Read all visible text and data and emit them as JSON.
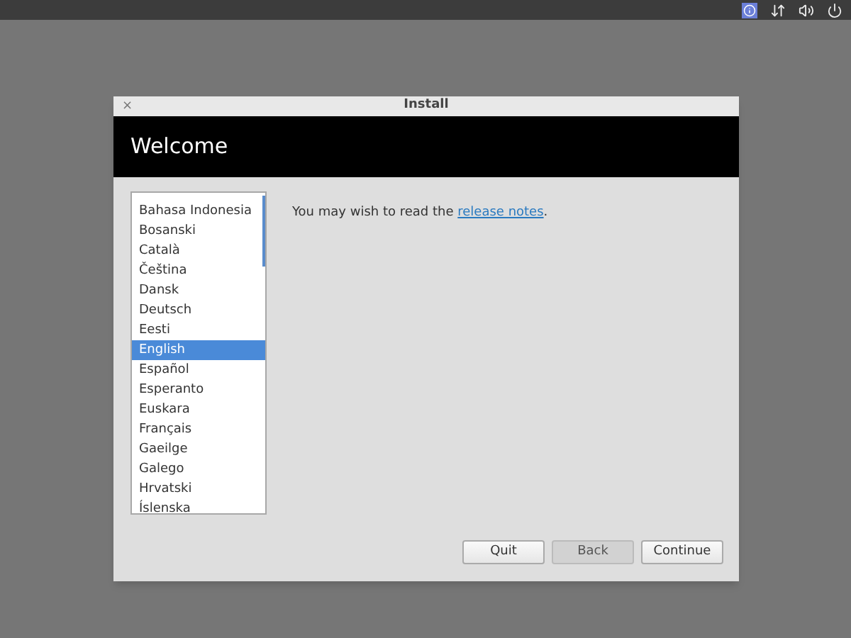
{
  "window": {
    "title": "Install",
    "close": "×"
  },
  "header": {
    "title": "Welcome"
  },
  "languages": [
    {
      "label": "Bahasa Indonesia",
      "selected": false
    },
    {
      "label": "Bosanski",
      "selected": false
    },
    {
      "label": "Català",
      "selected": false
    },
    {
      "label": "Čeština",
      "selected": false
    },
    {
      "label": "Dansk",
      "selected": false
    },
    {
      "label": "Deutsch",
      "selected": false
    },
    {
      "label": "Eesti",
      "selected": false
    },
    {
      "label": "English",
      "selected": true
    },
    {
      "label": "Español",
      "selected": false
    },
    {
      "label": "Esperanto",
      "selected": false
    },
    {
      "label": "Euskara",
      "selected": false
    },
    {
      "label": "Français",
      "selected": false
    },
    {
      "label": "Gaeilge",
      "selected": false
    },
    {
      "label": "Galego",
      "selected": false
    },
    {
      "label": "Hrvatski",
      "selected": false
    },
    {
      "label": "Íslenska",
      "selected": false
    }
  ],
  "message": {
    "before": "You may wish to read the",
    "link": "release notes",
    "after": "."
  },
  "buttons": [
    {
      "label": "Quit",
      "disabled": false
    },
    {
      "label": "Back",
      "disabled": true
    },
    {
      "label": "Continue",
      "disabled": false
    }
  ]
}
